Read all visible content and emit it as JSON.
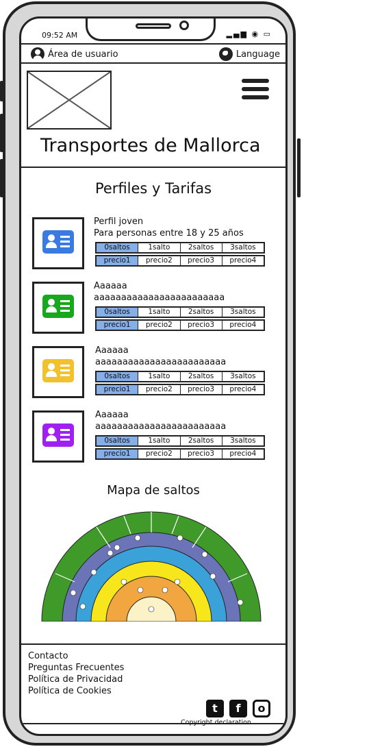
{
  "status": {
    "time": "09:52 AM"
  },
  "topbar": {
    "user_label": "Área de usuario",
    "language_label": "Language"
  },
  "header": {
    "title": "Transportes de Mallorca"
  },
  "profiles_section": {
    "title": "Perfiles y Tarifas",
    "profiles": [
      {
        "line1": "Perfil joven",
        "line2": "Para personas entre 18 y 25 años",
        "color": "#3b7ae0"
      },
      {
        "line1": "Aaaaaa",
        "line2": "aaaaaaaaaaaaaaaaaaaaaaaa",
        "color": "#18a81e"
      },
      {
        "line1": "Aaaaaa",
        "line2": "aaaaaaaaaaaaaaaaaaaaaaaa",
        "color": "#f2c12e"
      },
      {
        "line1": "Aaaaaa",
        "line2": "aaaaaaaaaaaaaaaaaaaaaaaa",
        "color": "#a020f0"
      }
    ],
    "saltos": [
      "0saltos",
      "1salto",
      "2saltos",
      "3saltos"
    ],
    "precios": [
      "precio1",
      "precio2",
      "precio3",
      "precio4"
    ],
    "selected_color": "#86aee8"
  },
  "map_section": {
    "title": "Mapa de saltos"
  },
  "footer": {
    "links": [
      "Contacto",
      "Preguntas Frecuentes",
      "Política de Privacidad",
      "Política de Cookies"
    ],
    "copyright": "Copyright declaration"
  }
}
